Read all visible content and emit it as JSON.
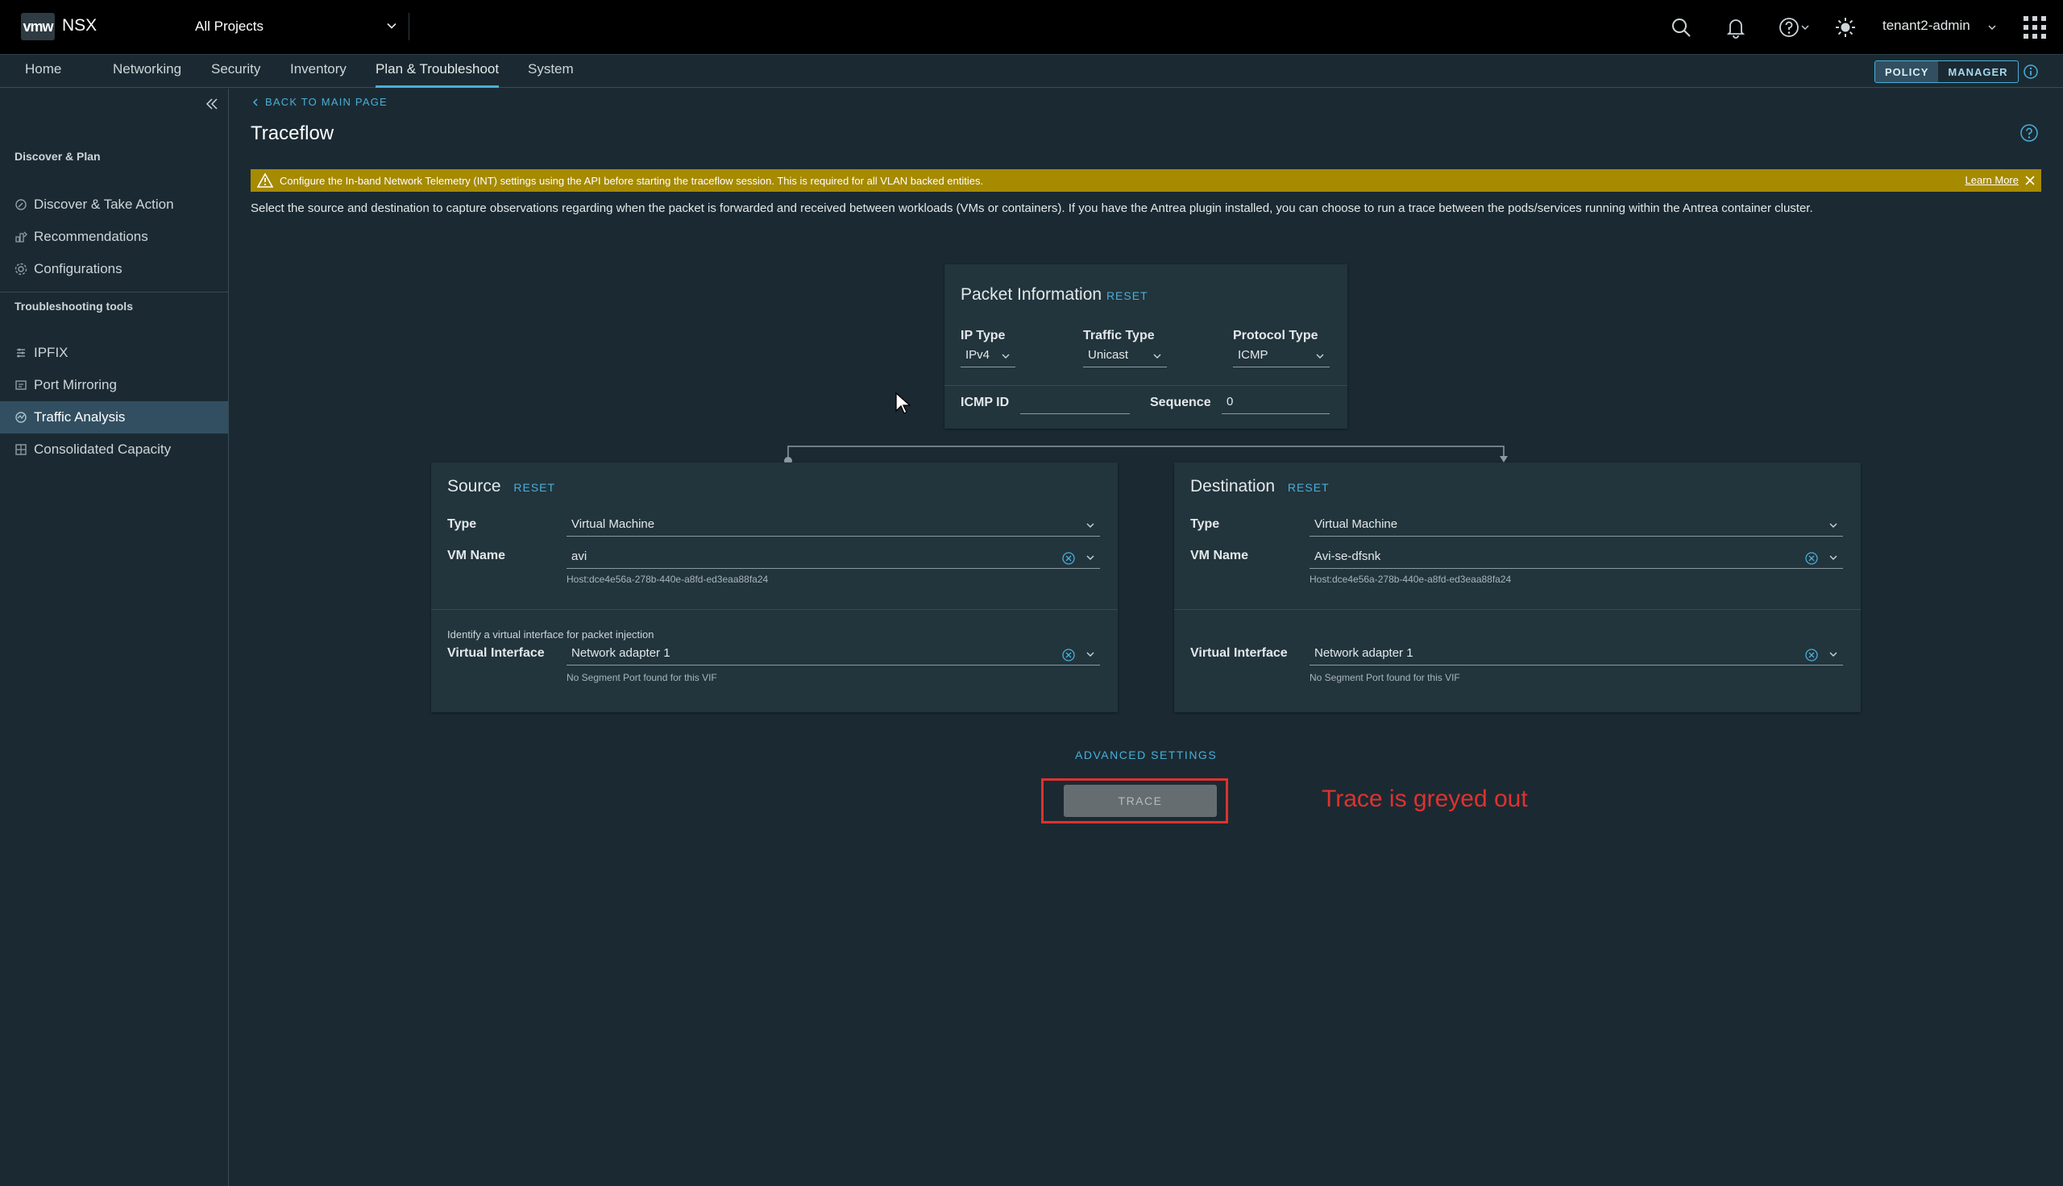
{
  "header": {
    "logo": "vmw",
    "product": "NSX",
    "project": "All Projects",
    "user": "tenant2-admin"
  },
  "nav": {
    "tabs": [
      {
        "label": "Home"
      },
      {
        "label": "Networking"
      },
      {
        "label": "Security"
      },
      {
        "label": "Inventory"
      },
      {
        "label": "Plan & Troubleshoot"
      },
      {
        "label": "System"
      }
    ],
    "active_tab": "Plan & Troubleshoot",
    "mode": {
      "policy": "POLICY",
      "manager": "MANAGER"
    }
  },
  "sidebar": {
    "section1": "Discover & Plan",
    "section1_items": [
      {
        "label": "Discover & Take Action",
        "icon": "discover-icon"
      },
      {
        "label": "Recommendations",
        "icon": "recommendations-icon"
      },
      {
        "label": "Configurations",
        "icon": "configurations-icon"
      }
    ],
    "section2": "Troubleshooting tools",
    "section2_items": [
      {
        "label": "IPFIX",
        "icon": "ipfix-icon"
      },
      {
        "label": "Port Mirroring",
        "icon": "port-mirroring-icon"
      },
      {
        "label": "Traffic Analysis",
        "icon": "traffic-analysis-icon"
      },
      {
        "label": "Consolidated Capacity",
        "icon": "capacity-icon"
      }
    ],
    "active_item": "Traffic Analysis"
  },
  "page": {
    "back": "BACK TO MAIN PAGE",
    "title": "Traceflow",
    "banner": "Configure the In-band Network Telemetry (INT) settings using the API before starting the traceflow session. This is required for all VLAN backed entities.",
    "banner_link": "Learn More",
    "description": "Select the source and destination to capture observations regarding when the packet is forwarded and received between workloads (VMs or containers). If you have the Antrea plugin installed, you can choose to run a trace between the pods/services running within the Antrea container cluster."
  },
  "packet": {
    "title": "Packet Information",
    "reset": "RESET",
    "ip_type_label": "IP Type",
    "ip_type": "IPv4",
    "traffic_type_label": "Traffic Type",
    "traffic_type": "Unicast",
    "protocol_type_label": "Protocol Type",
    "protocol_type": "ICMP",
    "icmp_id_label": "ICMP ID",
    "icmp_id": "",
    "sequence_label": "Sequence",
    "sequence": "0"
  },
  "source": {
    "title": "Source",
    "reset": "RESET",
    "type_label": "Type",
    "type": "Virtual Machine",
    "vm_label": "VM Name",
    "vm": "avi",
    "host": "Host:dce4e56a-278b-440e-a8fd-ed3eaa88fa24",
    "vif_hint": "Identify a virtual interface for packet injection",
    "vif_label": "Virtual Interface",
    "vif": "Network adapter 1",
    "vif_note": "No Segment Port found for this VIF"
  },
  "destination": {
    "title": "Destination",
    "reset": "RESET",
    "type_label": "Type",
    "type": "Virtual Machine",
    "vm_label": "VM Name",
    "vm": "Avi-se-dfsnk",
    "host": "Host:dce4e56a-278b-440e-a8fd-ed3eaa88fa24",
    "vif_label": "Virtual Interface",
    "vif": "Network adapter 1",
    "vif_note": "No Segment Port found for this VIF"
  },
  "actions": {
    "advanced": "ADVANCED SETTINGS",
    "trace": "TRACE",
    "trace_enabled": false
  },
  "annotation": "Trace is greyed out",
  "colors": {
    "accent": "#49afd9",
    "banner": "#a68a00",
    "annotation": "#e0312f",
    "background": "#1b2a32",
    "card": "#22343c"
  }
}
